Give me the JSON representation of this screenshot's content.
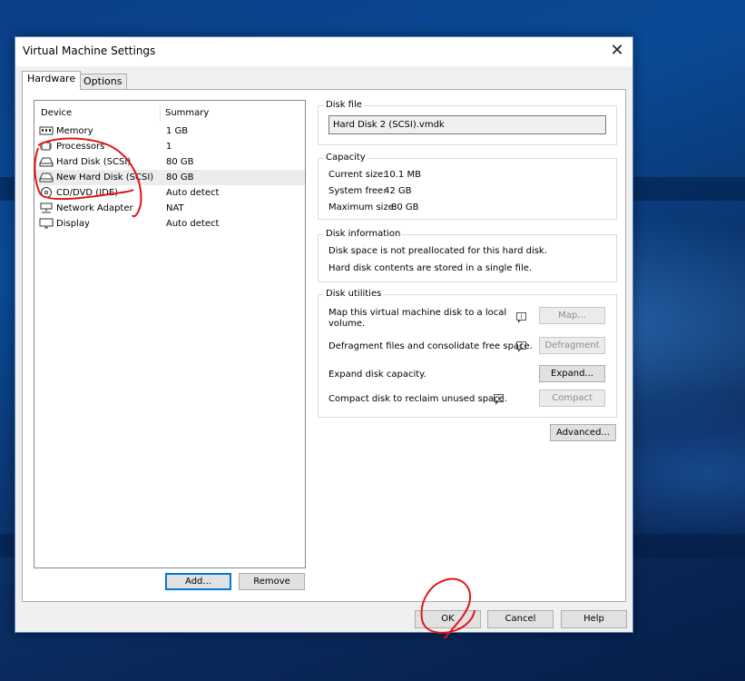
{
  "window": {
    "title": "Virtual Machine Settings",
    "tabs": [
      {
        "label": "Hardware",
        "active": true
      },
      {
        "label": "Options",
        "active": false
      }
    ]
  },
  "device_list": {
    "columns": {
      "device": "Device",
      "summary": "Summary"
    },
    "rows": [
      {
        "icon": "memory-icon",
        "device": "Memory",
        "summary": "1 GB"
      },
      {
        "icon": "processor-icon",
        "device": "Processors",
        "summary": "1"
      },
      {
        "icon": "hard-disk-icon",
        "device": "Hard Disk (SCSI)",
        "summary": "80 GB"
      },
      {
        "icon": "hard-disk-icon",
        "device": "New Hard Disk (SCSI)",
        "summary": "80 GB",
        "selected": true
      },
      {
        "icon": "cd-dvd-icon",
        "device": "CD/DVD (IDE)",
        "summary": "Auto detect"
      },
      {
        "icon": "network-adapter-icon",
        "device": "Network Adapter",
        "summary": "NAT"
      },
      {
        "icon": "display-icon",
        "device": "Display",
        "summary": "Auto detect"
      }
    ],
    "add_label": "Add...",
    "remove_label": "Remove"
  },
  "disk_file": {
    "label": "Disk file",
    "value": "Hard Disk 2 (SCSI).vmdk"
  },
  "capacity": {
    "label": "Capacity",
    "current_label": "Current size:",
    "current_value": "10.1 MB",
    "free_label": "System free:",
    "free_value": "42 GB",
    "max_label": "Maximum size:",
    "max_value": "80 GB"
  },
  "disk_information": {
    "label": "Disk information",
    "line1": "Disk space is not preallocated for this hard disk.",
    "line2": "Hard disk contents are stored in a single file."
  },
  "disk_utilities": {
    "label": "Disk utilities",
    "map_text_1": "Map this virtual machine disk to a local",
    "map_text_2": "volume.",
    "map_button": "Map...",
    "defrag_text": "Defragment files and consolidate free space.",
    "defrag_button": "Defragment",
    "expand_text": "Expand disk capacity.",
    "expand_button": "Expand...",
    "compact_text": "Compact disk to reclaim unused space.",
    "compact_button": "Compact",
    "info_glyph": "i"
  },
  "advanced_button": "Advanced...",
  "footer": {
    "ok": "OK",
    "cancel": "Cancel",
    "help": "Help"
  },
  "close_glyph": "✕",
  "colors": {
    "accent": "#0078d7",
    "annotation": "#e0161b",
    "desktop": "#0a3f84"
  }
}
